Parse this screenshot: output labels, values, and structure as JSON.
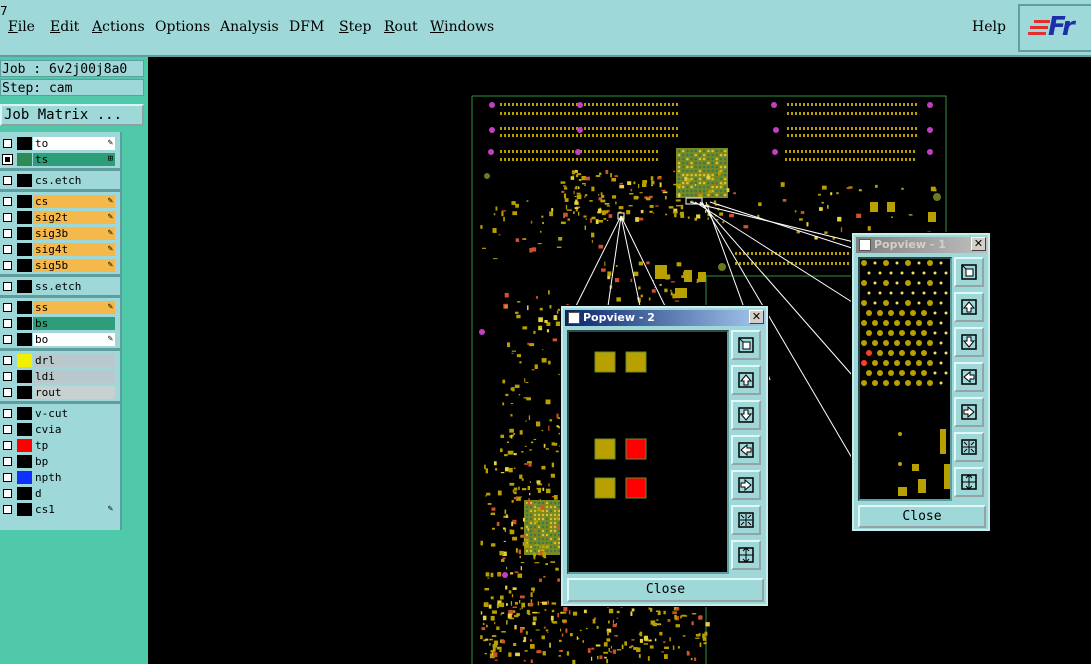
{
  "menubar": {
    "items": [
      {
        "label": "File",
        "underline": "F",
        "rest": "ile"
      },
      {
        "label": "Edit",
        "underline": "E",
        "rest": "dit"
      },
      {
        "label": "Actions",
        "underline": "A",
        "rest": "ctions"
      },
      {
        "label": "Options",
        "underline": "",
        "rest": "Options"
      },
      {
        "label": "Analysis",
        "underline": "",
        "rest": "Analysis"
      },
      {
        "label": "DFM",
        "underline": "",
        "rest": "DFM"
      },
      {
        "label": "Step",
        "underline": "S",
        "rest": "tep"
      },
      {
        "label": "Rout",
        "underline": "R",
        "rest": "out"
      },
      {
        "label": "Windows",
        "underline": "W",
        "rest": "indows"
      }
    ],
    "help": "Help",
    "logo_text": "Fr"
  },
  "job": {
    "job_line": "Job : 6v2j00j8a0",
    "step_line": "Step: cam",
    "job_matrix_button": "Job Matrix ..."
  },
  "layers": [
    {
      "name": "to",
      "swatch": "#000000",
      "bg": "#ffffff",
      "edit": true,
      "checked": false
    },
    {
      "name": "ts",
      "swatch": "#2e8b57",
      "bg": "#2e9e7a",
      "edit": false,
      "checked": true,
      "pin": true
    },
    {
      "name": "cs.etch",
      "swatch": "#000000",
      "bg": "#9ed8d8",
      "edit": false,
      "checked": false
    },
    {
      "name": "cs",
      "swatch": "#000000",
      "bg": "#f5b84a",
      "edit": true,
      "checked": false
    },
    {
      "name": "sig2t",
      "swatch": "#000000",
      "bg": "#f5b84a",
      "edit": true,
      "checked": false
    },
    {
      "name": "sig3b",
      "swatch": "#000000",
      "bg": "#f5b84a",
      "edit": true,
      "checked": false
    },
    {
      "name": "sig4t",
      "swatch": "#000000",
      "bg": "#f5b84a",
      "edit": true,
      "checked": false
    },
    {
      "name": "sig5b",
      "swatch": "#000000",
      "bg": "#f5b84a",
      "edit": true,
      "checked": false
    },
    {
      "name": "ss.etch",
      "swatch": "#000000",
      "bg": "#9ed8d8",
      "edit": false,
      "checked": false
    },
    {
      "name": "ss",
      "swatch": "#000000",
      "bg": "#f5b84a",
      "edit": true,
      "checked": false
    },
    {
      "name": "bs",
      "swatch": "#000000",
      "bg": "#2e9e7a",
      "edit": false,
      "checked": false
    },
    {
      "name": "bo",
      "swatch": "#000000",
      "bg": "#ffffff",
      "edit": true,
      "checked": false
    },
    {
      "name": "drl",
      "swatch": "#f0f000",
      "bg": "#b8c8cc",
      "edit": false,
      "checked": false
    },
    {
      "name": "ldi",
      "swatch": "#000000",
      "bg": "#b8c8cc",
      "edit": false,
      "checked": false
    },
    {
      "name": "rout",
      "swatch": "#000000",
      "bg": "#c8d0d0",
      "edit": false,
      "checked": false
    },
    {
      "name": "v-cut",
      "swatch": "#000000",
      "bg": "#9ed8d8",
      "edit": false,
      "checked": false
    },
    {
      "name": "cvia",
      "swatch": "#000000",
      "bg": "#9ed8d8",
      "edit": false,
      "checked": false
    },
    {
      "name": "tp",
      "swatch": "#ff0000",
      "bg": "#9ed8d8",
      "edit": false,
      "checked": false
    },
    {
      "name": "bp",
      "swatch": "#000000",
      "bg": "#9ed8d8",
      "edit": false,
      "checked": false
    },
    {
      "name": "npth",
      "swatch": "#1030ff",
      "bg": "#9ed8d8",
      "edit": false,
      "checked": false
    },
    {
      "name": "d",
      "swatch": "#000000",
      "bg": "#9ed8d8",
      "edit": false,
      "checked": false
    },
    {
      "name": "cs1",
      "swatch": "#000000",
      "bg": "#9ed8d8",
      "edit": true,
      "checked": false
    }
  ],
  "popview2": {
    "title": "Popview - 2",
    "close_label": "Close",
    "active": true
  },
  "popview1": {
    "title": "Popview - 1",
    "close_label": "Close",
    "active": false
  },
  "popview_buttons": [
    "zoom-fit-icon",
    "pan-up-icon",
    "pan-down-icon",
    "pan-left-icon",
    "pan-right-icon",
    "zoom-out-icon",
    "zoom-in-icon"
  ],
  "colors": {
    "accent": "#9ed8d8",
    "panel": "#50c8aa",
    "pad_olive": "#b8a000",
    "pad_red": "#ff0000",
    "board_outline": "#2f8f3f"
  }
}
